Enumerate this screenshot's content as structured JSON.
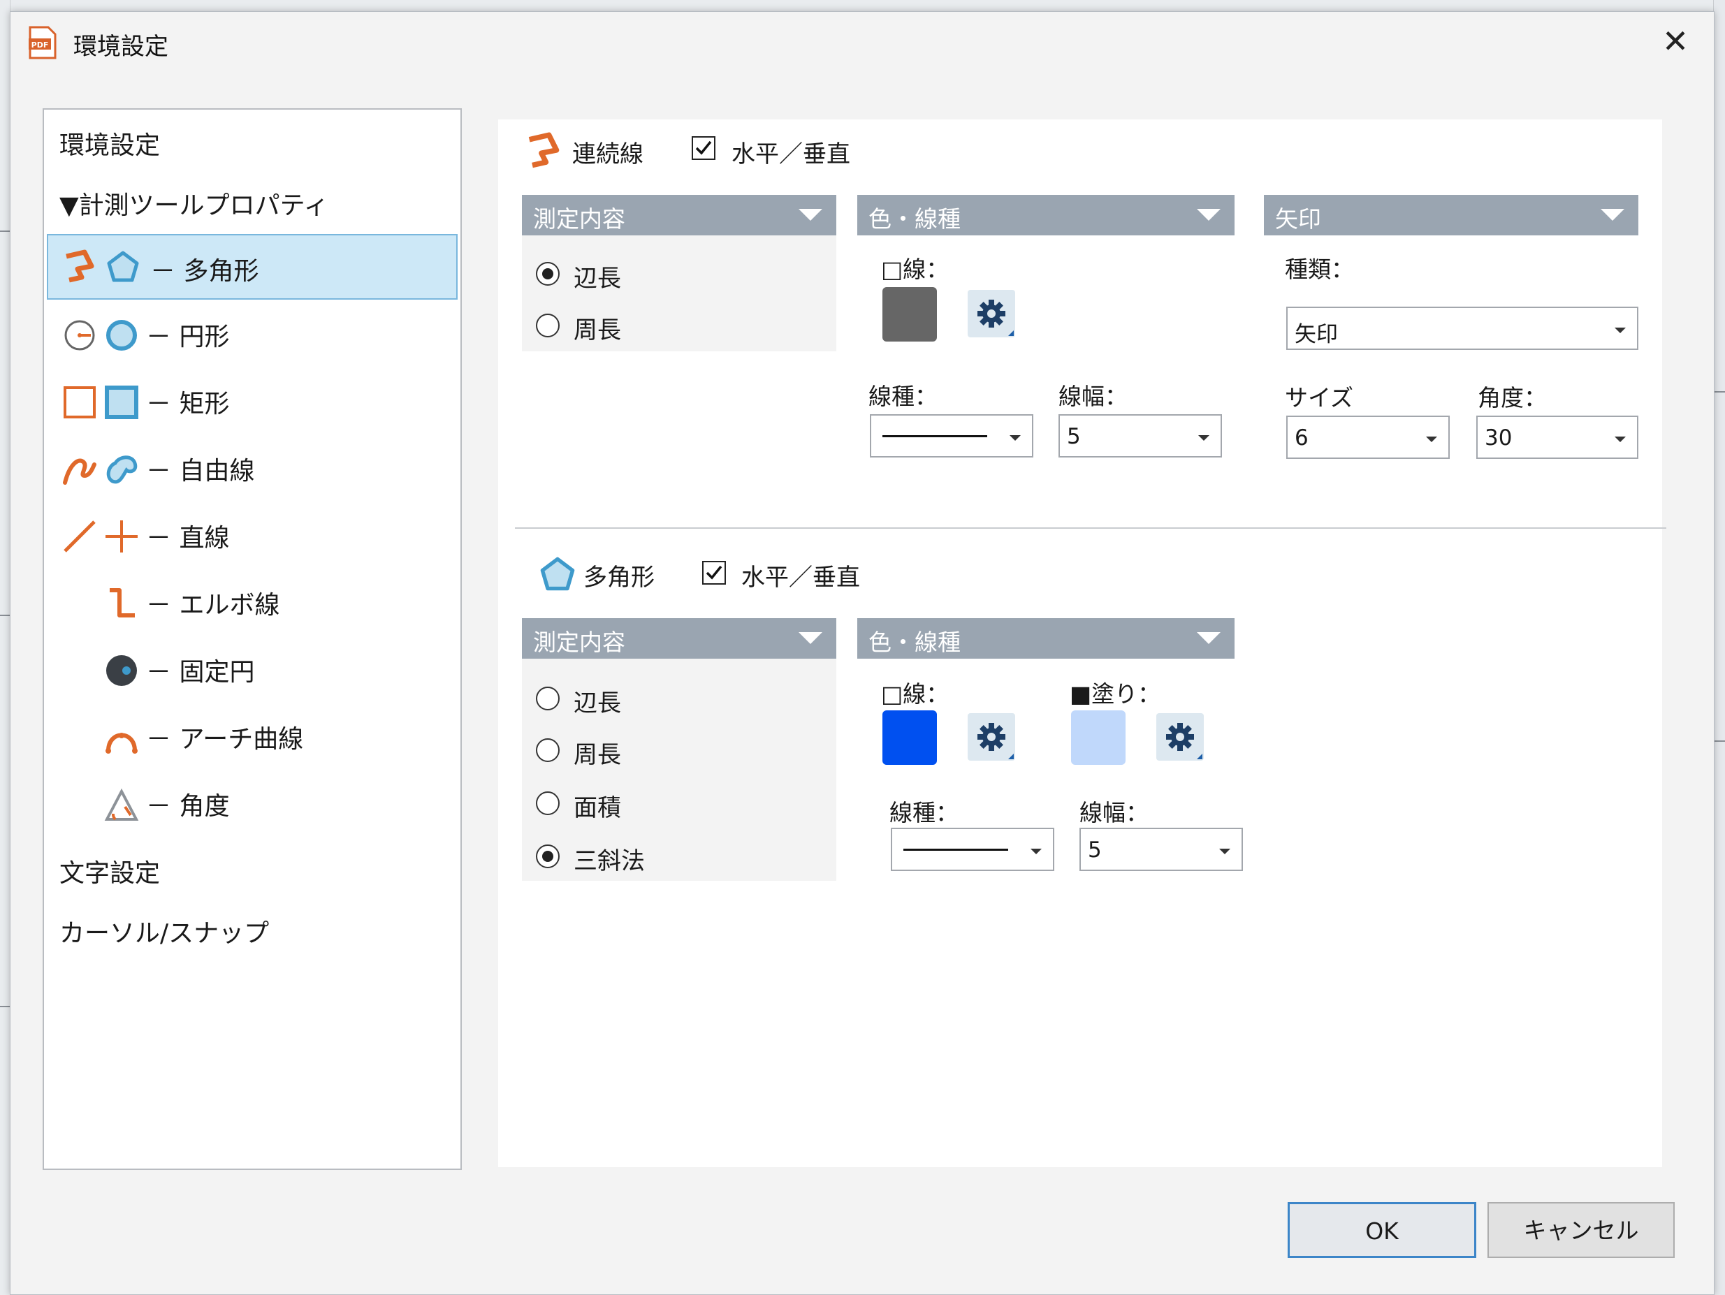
{
  "window": {
    "title": "環境設定",
    "close_symbol": "✕"
  },
  "tree": {
    "items": [
      {
        "label": "環境設定"
      },
      {
        "label": "▼計測ツールプロパティ"
      },
      {
        "label": "－ 多角形"
      },
      {
        "label": "－ 円形"
      },
      {
        "label": "－ 矩形"
      },
      {
        "label": "－ 自由線"
      },
      {
        "label": "－ 直線"
      },
      {
        "label": "－ エルボ線"
      },
      {
        "label": "－ 固定円"
      },
      {
        "label": "－ アーチ曲線"
      },
      {
        "label": "－ 角度"
      },
      {
        "label": "文字設定"
      },
      {
        "label": "カーソル/スナップ"
      }
    ]
  },
  "polyline": {
    "title": "連続線",
    "checkbox_label": "水平／垂直",
    "checkbox_checked": true,
    "measure": {
      "header": "測定内容",
      "options": [
        {
          "label": "辺長",
          "selected": true
        },
        {
          "label": "周長",
          "selected": false
        }
      ]
    },
    "style": {
      "header": "色・線種",
      "line_label": "□線：",
      "line_color": "#666666",
      "line_type_label": "線種：",
      "line_width_label": "線幅：",
      "line_width_value": "5"
    },
    "arrow": {
      "header": "矢印",
      "type_label": "種類：",
      "type_value": "矢印",
      "size_label": "サイズ",
      "size_value": "6",
      "angle_label": "角度：",
      "angle_value": "30"
    }
  },
  "polygon": {
    "title": "多角形",
    "checkbox_label": "水平／垂直",
    "checkbox_checked": true,
    "measure": {
      "header": "測定内容",
      "options": [
        {
          "label": "辺長",
          "selected": false
        },
        {
          "label": "周長",
          "selected": false
        },
        {
          "label": "面積",
          "selected": false
        },
        {
          "label": "三斜法",
          "selected": true
        }
      ]
    },
    "style": {
      "header": "色・線種",
      "line_label": "□線：",
      "line_color": "#0050f0",
      "fill_label": "■塗り：",
      "fill_color": "#c0d8fb",
      "line_type_label": "線種：",
      "line_width_label": "線幅：",
      "line_width_value": "5"
    }
  },
  "buttons": {
    "ok": "OK",
    "cancel": "キャンセル"
  },
  "colors": {
    "accent_orange": "#e0692a",
    "accent_blue": "#3e9acb",
    "header_gray": "#9aa5b1",
    "selected_bg": "#cde8f7"
  }
}
